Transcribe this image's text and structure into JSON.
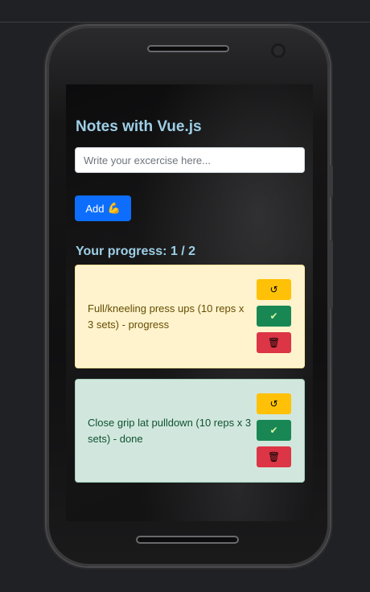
{
  "app": {
    "title": "Notes with Vue.js",
    "input": {
      "placeholder": "Write your excercise here...",
      "value": ""
    },
    "add_button": {
      "label": "Add",
      "emoji": "💪"
    },
    "progress": {
      "label": "Your progress: 1 / 2",
      "done": 1,
      "total": 2
    }
  },
  "notes": [
    {
      "text": "Full/kneeling press ups (10 reps x 3 sets) - progress",
      "status": "progress",
      "color": "#fff3cd",
      "actions": {
        "undo_glyph": "↺",
        "done_glyph": "✔",
        "delete_glyph": "🗑"
      }
    },
    {
      "text": "Close grip lat pulldown (10 reps x 3 sets) - done",
      "status": "done",
      "color": "#d1e7dd",
      "actions": {
        "undo_glyph": "↺",
        "done_glyph": "✔",
        "delete_glyph": "🗑"
      }
    }
  ],
  "colors": {
    "accent_text": "#9ecfe6",
    "primary": "#0d6efd",
    "warning": "#ffc107",
    "success": "#198754",
    "danger": "#dc3545"
  }
}
